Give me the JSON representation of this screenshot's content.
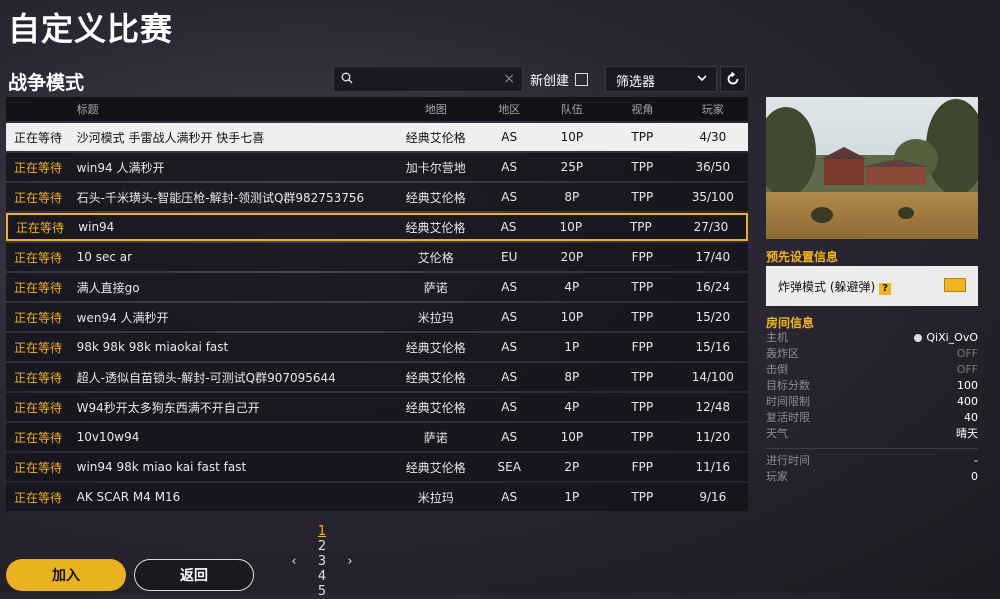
{
  "page_title": "自定义比赛",
  "mode_title": "战争模式",
  "search": {
    "placeholder": "",
    "clear_icon": "close-icon"
  },
  "new_create_label": "新创建",
  "filter_label": "筛选器",
  "table": {
    "headers": {
      "title": "标题",
      "map": "地图",
      "region": "地区",
      "team": "队伍",
      "view": "视角",
      "players": "玩家"
    },
    "rows": [
      {
        "status": "正在等待",
        "title": "沙河模式 手雷战人满秒开 快手七喜",
        "map": "经典艾伦格",
        "region": "AS",
        "team": "10P",
        "view": "TPP",
        "players": "4/30"
      },
      {
        "status": "正在等待",
        "title": "win94 人满秒开",
        "map": "加卡尔营地",
        "region": "AS",
        "team": "25P",
        "view": "TPP",
        "players": "36/50"
      },
      {
        "status": "正在等待",
        "title": "石头-千米璜头-智能压枪-解封-领测试Q群982753756",
        "map": "经典艾伦格",
        "region": "AS",
        "team": "8P",
        "view": "TPP",
        "players": "35/100"
      },
      {
        "status": "正在等待",
        "title": "win94",
        "map": "经典艾伦格",
        "region": "AS",
        "team": "10P",
        "view": "TPP",
        "players": "27/30"
      },
      {
        "status": "正在等待",
        "title": "10 sec ar",
        "map": "艾伦格",
        "region": "EU",
        "team": "20P",
        "view": "FPP",
        "players": "17/40"
      },
      {
        "status": "正在等待",
        "title": "满人直接go",
        "map": "萨诺",
        "region": "AS",
        "team": "4P",
        "view": "TPP",
        "players": "16/24"
      },
      {
        "status": "正在等待",
        "title": "wen94 人满秒开",
        "map": "米拉玛",
        "region": "AS",
        "team": "10P",
        "view": "TPP",
        "players": "15/20"
      },
      {
        "status": "正在等待",
        "title": "98k 98k 98k miaokai fast",
        "map": "经典艾伦格",
        "region": "AS",
        "team": "1P",
        "view": "FPP",
        "players": "15/16"
      },
      {
        "status": "正在等待",
        "title": "超人-透似自苗锁头-解封-可测试Q群907095644",
        "map": "经典艾伦格",
        "region": "AS",
        "team": "8P",
        "view": "TPP",
        "players": "14/100"
      },
      {
        "status": "正在等待",
        "title": "W94秒开太多狗东西满不开自己开",
        "map": "经典艾伦格",
        "region": "AS",
        "team": "4P",
        "view": "TPP",
        "players": "12/48"
      },
      {
        "status": "正在等待",
        "title": "10v10w94",
        "map": "萨诺",
        "region": "AS",
        "team": "10P",
        "view": "TPP",
        "players": "11/20"
      },
      {
        "status": "正在等待",
        "title": "win94 98k miao kai fast fast",
        "map": "经典艾伦格",
        "region": "SEA",
        "team": "2P",
        "view": "FPP",
        "players": "11/16"
      },
      {
        "status": "正在等待",
        "title": "AK SCAR M4 M16",
        "map": "米拉玛",
        "region": "AS",
        "team": "1P",
        "view": "TPP",
        "players": "9/16"
      }
    ]
  },
  "pagination": {
    "prev": "‹",
    "pages": [
      "1",
      "2",
      "3",
      "4",
      "5"
    ],
    "next": "›",
    "current": "1"
  },
  "buttons": {
    "join": "加入",
    "back": "返回"
  },
  "preset": {
    "title": "预先设置信息",
    "mode": "炸弹模式 (躲避弹)",
    "help": "?"
  },
  "room": {
    "title": "房间信息",
    "rows": [
      {
        "key": "主机",
        "value": "QiXi_OvO"
      },
      {
        "key": "轰炸区",
        "value": "OFF"
      },
      {
        "key": "击倒",
        "value": "OFF"
      },
      {
        "key": "目标分数",
        "value": "100"
      },
      {
        "key": "时间限制",
        "value": "400"
      },
      {
        "key": "复活时限",
        "value": "40"
      },
      {
        "key": "天气",
        "value": "晴天"
      }
    ],
    "extra": [
      {
        "key": "进行时间",
        "value": "-"
      },
      {
        "key": "玩家",
        "value": "0"
      }
    ]
  },
  "colors": {
    "accent": "#f2b41c",
    "selected_row": "#efefef",
    "row_bg": "#14121a"
  }
}
